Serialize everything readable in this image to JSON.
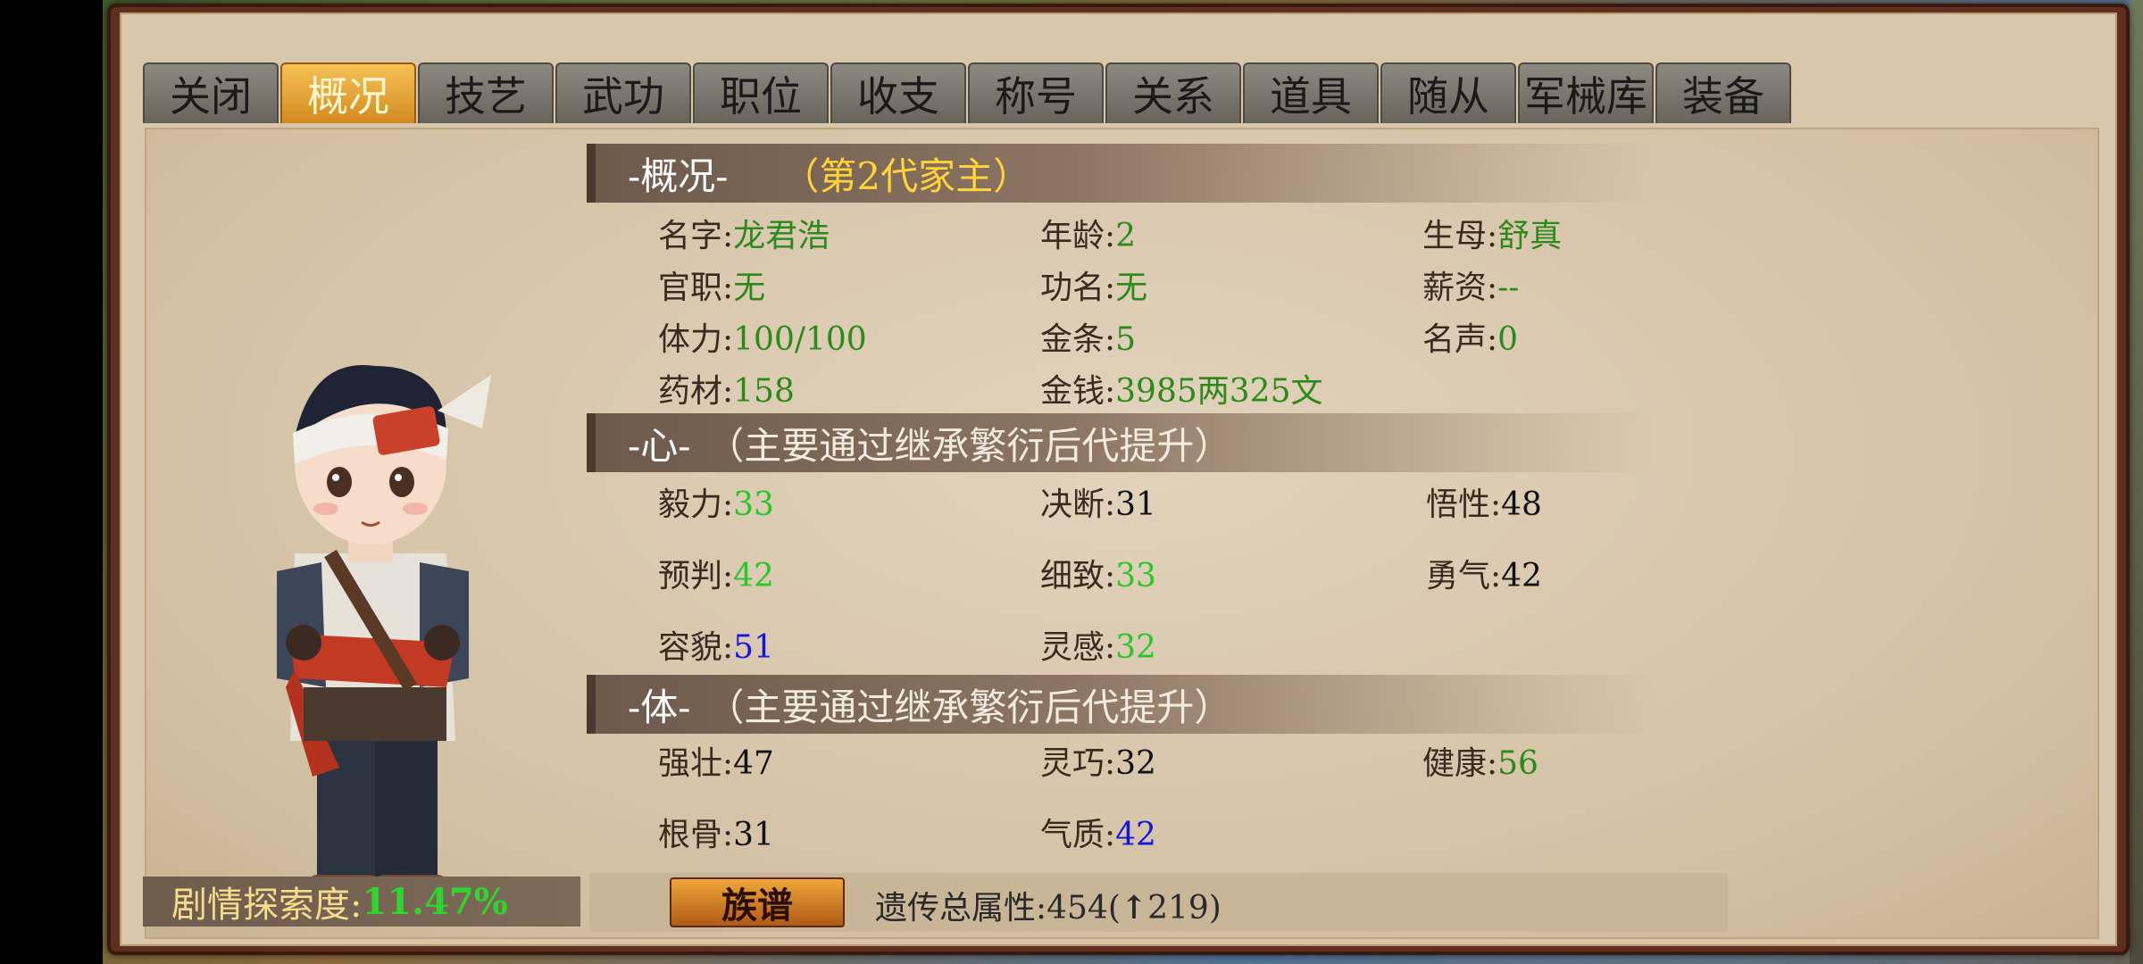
{
  "tabs": [
    "关闭",
    "概况",
    "技艺",
    "武功",
    "职位",
    "收支",
    "称号",
    "关系",
    "道具",
    "随从",
    "军械库",
    "装备"
  ],
  "active_tab": "概况",
  "sections": {
    "overview": {
      "title": "-概况-",
      "subtitle": "（第2代家主）"
    },
    "heart": {
      "title": "-心-",
      "subtitle": "（主要通过继承繁衍后代提升）"
    },
    "body": {
      "title": "-体-",
      "subtitle": "（主要通过继承繁衍后代提升）"
    }
  },
  "overview": {
    "name": {
      "label": "名字:",
      "value": "龙君浩"
    },
    "age": {
      "label": "年龄:",
      "value": "2"
    },
    "mother": {
      "label": "生母:",
      "value": "舒真"
    },
    "office": {
      "label": "官职:",
      "value": "无"
    },
    "merit": {
      "label": "功名:",
      "value": "无"
    },
    "salary": {
      "label": "薪资:",
      "value": "--"
    },
    "stamina": {
      "label": "体力:",
      "value": "100/100"
    },
    "gold_bars": {
      "label": "金条:",
      "value": "5"
    },
    "fame": {
      "label": "名声:",
      "value": "0"
    },
    "herbs": {
      "label": "药材:",
      "value": "158"
    },
    "money": {
      "label": "金钱:",
      "value": "3985两325文"
    }
  },
  "heart": {
    "perseverance": {
      "label": "毅力:",
      "value": "33"
    },
    "decisiveness": {
      "label": "决断:",
      "value": "31"
    },
    "insight": {
      "label": "悟性:",
      "value": "48"
    },
    "foresight": {
      "label": "预判:",
      "value": "42"
    },
    "meticulous": {
      "label": "细致:",
      "value": "33"
    },
    "courage": {
      "label": "勇气:",
      "value": "42"
    },
    "appearance": {
      "label": "容貌:",
      "value": "51"
    },
    "inspiration": {
      "label": "灵感:",
      "value": "32"
    }
  },
  "body": {
    "strength": {
      "label": "强壮:",
      "value": "47"
    },
    "agility": {
      "label": "灵巧:",
      "value": "32"
    },
    "health": {
      "label": "健康:",
      "value": "56"
    },
    "bones": {
      "label": "根骨:",
      "value": "31"
    },
    "temperament": {
      "label": "气质:",
      "value": "42"
    }
  },
  "footer": {
    "explore_label": "剧情探索度:",
    "explore_value": "11.47%",
    "genealogy_button": "族谱",
    "genetic_label": "遗传总属性:454(",
    "genetic_arrow": "↑",
    "genetic_gain": "219)"
  },
  "colors": {
    "green_dark": "#2b8a1a",
    "green_bright": "#28c828",
    "blue": "#1515e0",
    "tab_active": "#f5c254",
    "header_gold": "#ffd33a"
  }
}
